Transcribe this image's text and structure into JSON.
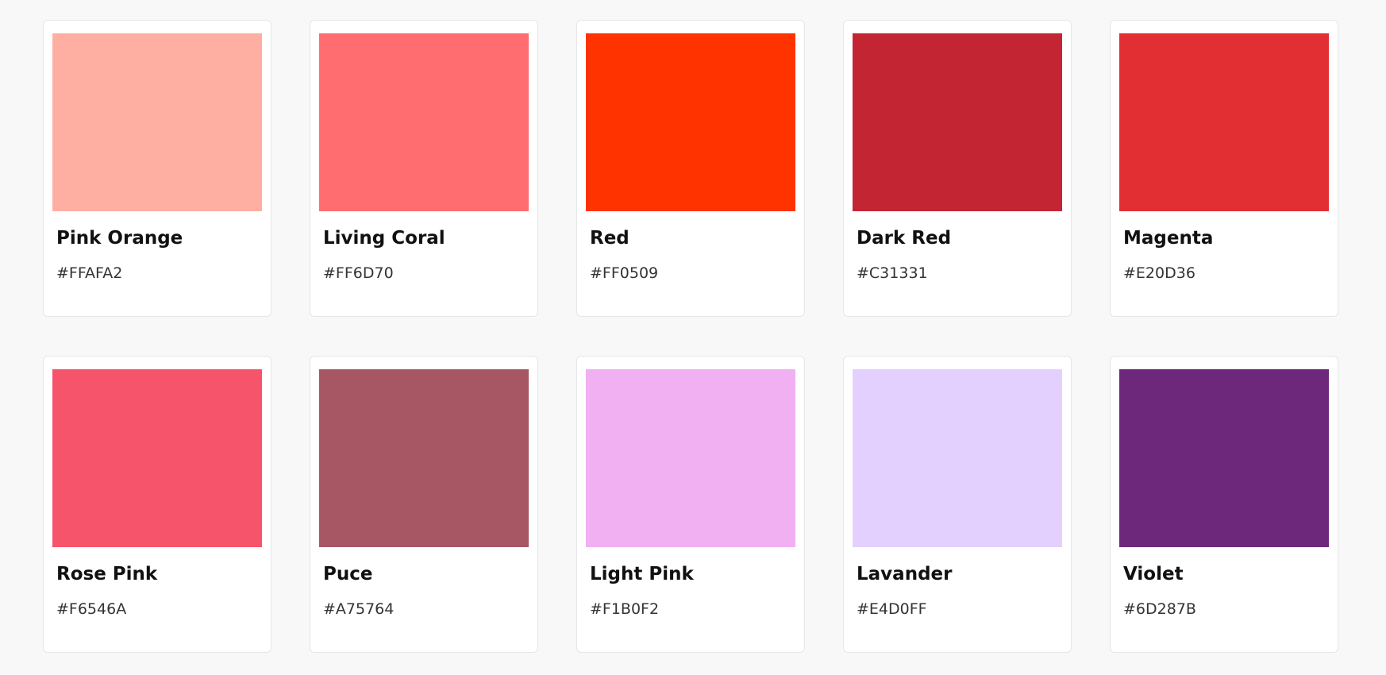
{
  "palette": {
    "colors": [
      {
        "name": "Pink Orange",
        "hex": "#FFAFA2"
      },
      {
        "name": "Living Coral",
        "hex": "#FF6D70"
      },
      {
        "name": "Red",
        "hex": "#FF0509"
      },
      {
        "name": "Dark Red",
        "hex": "#C31331"
      },
      {
        "name": "Magenta",
        "hex": "#E20D36"
      },
      {
        "name": "Rose Pink",
        "hex": "#F6546A"
      },
      {
        "name": "Puce",
        "hex": "#A75764"
      },
      {
        "name": "Light Pink",
        "hex": "#F1B0F2"
      },
      {
        "name": "Lavander",
        "hex": "#E4D0FF"
      },
      {
        "name": "Violet",
        "hex": "#6D287B"
      }
    ],
    "display_colors": [
      "#FFAFA2",
      "#FF6D70",
      "#FF3300",
      "#C42533",
      "#E22F34",
      "#F6546A",
      "#A75764",
      "#F1B0F2",
      "#E4D0FF",
      "#6D287B"
    ]
  }
}
